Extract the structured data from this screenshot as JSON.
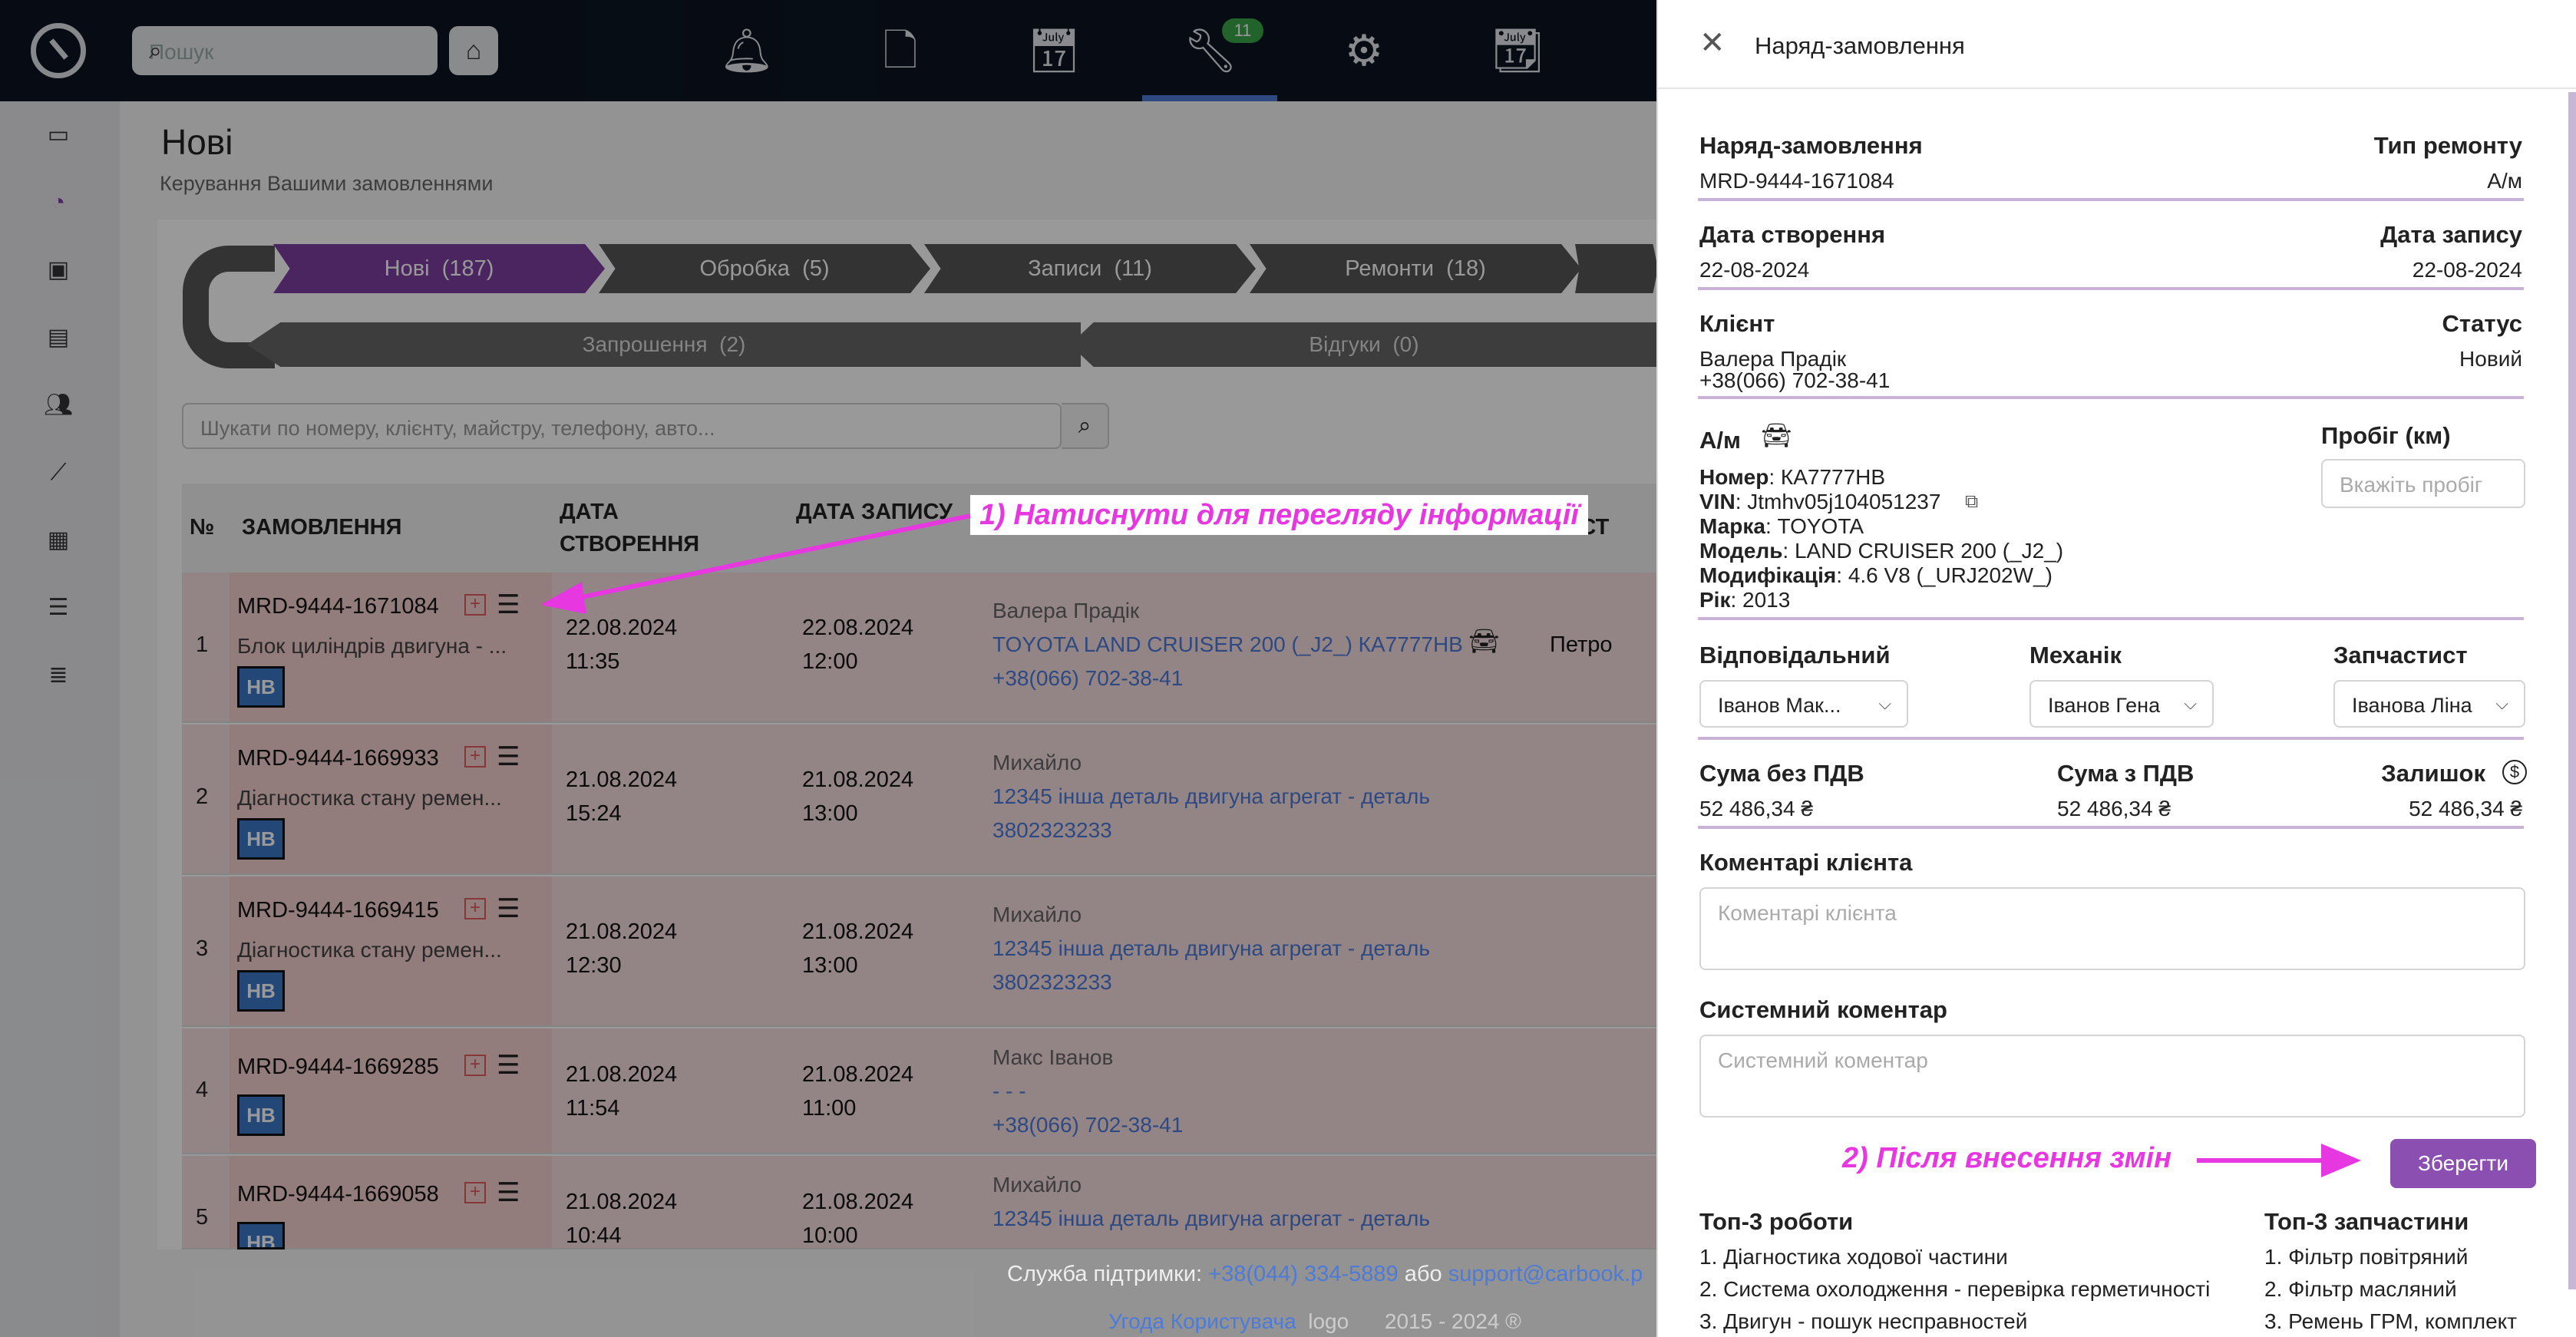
{
  "topbar": {
    "search_placeholder": "Пошук",
    "badge_count": "11"
  },
  "page": {
    "title": "Нові",
    "subtitle": "Керування Вашими замовленнями"
  },
  "pipeline": {
    "row1": [
      {
        "label": "Нові",
        "count": "(187)"
      },
      {
        "label": "Обробка",
        "count": "(5)"
      },
      {
        "label": "Записи",
        "count": "(11)"
      },
      {
        "label": "Ремонти",
        "count": "(18)"
      }
    ],
    "row2": [
      {
        "label": "Запрошення",
        "count": "(2)"
      },
      {
        "label": "Відгуки",
        "count": "(0)"
      }
    ]
  },
  "table_search": {
    "placeholder": "Шукати по номеру, клієнту, майстру, телефону, авто..."
  },
  "table": {
    "headers": {
      "num": "№",
      "order": "ЗАМОВЛЕННЯ",
      "created": "ДАТА СТВОРЕННЯ",
      "appointment": "ДАТА ЗАПИСУ",
      "post": "ПОСТ"
    },
    "rows": [
      {
        "num": "1",
        "order": "MRD-9444-1671084",
        "desc": "Блок циліндрів двигуна - ...",
        "badge": "НВ",
        "created_date": "22.08.2024",
        "created_time": "11:35",
        "appt_date": "22.08.2024",
        "appt_time": "12:00",
        "client": "Валера Прадік",
        "car": "TOYOTA LAND CRUISER 200 (_J2_) КА7777НВ",
        "phone": "+38(066) 702-38-41",
        "master": "Петро"
      },
      {
        "num": "2",
        "order": "MRD-9444-1669933",
        "desc": "Діагностика стану ремен...",
        "badge": "НВ",
        "created_date": "21.08.2024",
        "created_time": "15:24",
        "appt_date": "21.08.2024",
        "appt_time": "13:00",
        "client": "Михайло",
        "car": "12345 інша деталь двигуна агрегат - деталь",
        "phone": "3802323233",
        "master": ""
      },
      {
        "num": "3",
        "order": "MRD-9444-1669415",
        "desc": "Діагностика стану ремен...",
        "badge": "НВ",
        "created_date": "21.08.2024",
        "created_time": "12:30",
        "appt_date": "21.08.2024",
        "appt_time": "13:00",
        "client": "Михайло",
        "car": "12345 інша деталь двигуна агрегат - деталь",
        "phone": "3802323233",
        "master": ""
      },
      {
        "num": "4",
        "order": "MRD-9444-1669285",
        "desc": "",
        "badge": "НВ",
        "created_date": "21.08.2024",
        "created_time": "11:54",
        "appt_date": "21.08.2024",
        "appt_time": "11:00",
        "client": "Макс Іванов",
        "car": "- - -",
        "phone": "+38(066) 702-38-41",
        "master": ""
      },
      {
        "num": "5",
        "order": "MRD-9444-1669058",
        "desc": "",
        "badge": "НВ",
        "created_date": "21.08.2024",
        "created_time": "10:44",
        "appt_date": "21.08.2024",
        "appt_time": "10:00",
        "client": "Михайло",
        "car": "12345 інша деталь двигуна агрегат - деталь",
        "phone": "",
        "master": ""
      }
    ]
  },
  "footer": {
    "support_label": "Служба підтримки:",
    "phone": "+38(044) 334-5889",
    "or": "або",
    "email": "support@carbook.p",
    "agreement": "Угода Користувача",
    "logo_alt": "logo",
    "years": "2015 - 2024 ®"
  },
  "drawer": {
    "title": "Наряд-замовлення",
    "order_label": "Наряд-замовлення",
    "order_value": "MRD-9444-1671084",
    "repair_type_label": "Тип ремонту",
    "repair_type_value": "А/м",
    "created_label": "Дата створення",
    "created_value": "22-08-2024",
    "appt_label": "Дата запису",
    "appt_value": "22-08-2024",
    "client_label": "Клієнт",
    "client_name": "Валера Прадік",
    "client_phone": "+38(066) 702-38-41",
    "status_label": "Статус",
    "status_value": "Новий",
    "car_label": "А/м",
    "mileage_label": "Пробіг (км)",
    "mileage_placeholder": "Вкажіть пробіг",
    "car_fields": [
      {
        "label": "Номер",
        "value": "КА7777НВ"
      },
      {
        "label": "VIN",
        "value": "Jtmhv05j104051237"
      },
      {
        "label": "Марка",
        "value": "TOYOTA"
      },
      {
        "label": "Модель",
        "value": "LAND CRUISER 200 (_J2_)"
      },
      {
        "label": "Модифікація",
        "value": "4.6 V8 (_URJ202W_)"
      },
      {
        "label": "Рік",
        "value": "2013"
      }
    ],
    "responsible_label": "Відповідальний",
    "responsible_value": "Іванов Мак...",
    "mechanic_label": "Механік",
    "mechanic_value": "Іванов Гена",
    "parts_label": "Запчастист",
    "parts_value": "Іванова Ліна",
    "sum_no_vat_label": "Сума без ПДВ",
    "sum_no_vat_value": "52 486,34 ₴",
    "sum_vat_label": "Сума з ПДВ",
    "sum_vat_value": "52 486,34 ₴",
    "balance_label": "Залишок",
    "balance_value": "52 486,34 ₴",
    "client_comments_label": "Коментарі клієнта",
    "client_comments_placeholder": "Коментарі клієнта",
    "system_comment_label": "Системний коментар",
    "system_comment_placeholder": "Системний коментар",
    "save_label": "Зберегти",
    "top_works_label": "Топ-3 роботи",
    "top_works": [
      "1. Діагностика ходової частини",
      "2. Система охолодження - перевірка герметичності",
      "3. Двигун - пошук несправностей"
    ],
    "top_parts_label": "Топ-3 запчастини",
    "top_parts": [
      "1. Фільтр повітряний",
      "2. Фільтр масляний",
      "3. Ремень ГРМ, комплект"
    ]
  },
  "annotations": {
    "step1": "1) Натиснути для перегляду інформації",
    "step2": "2) Після внесення змін"
  },
  "colors": {
    "accent": "#8a4fb0",
    "annotation": "#e637e0",
    "topbar": "#0c1522",
    "link": "#4d7bd9"
  }
}
